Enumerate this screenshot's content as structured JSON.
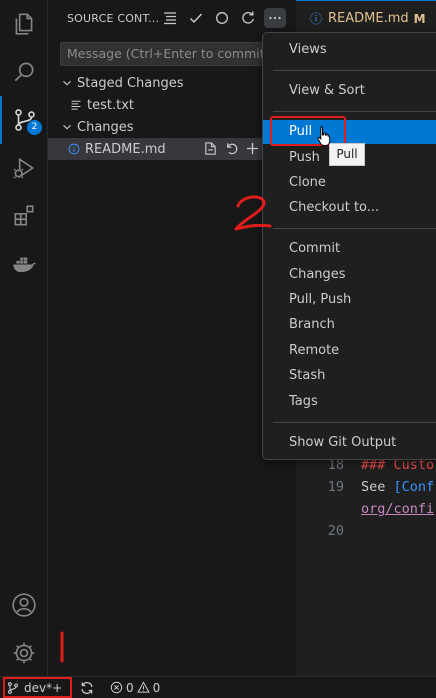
{
  "activity_bar": {
    "items": [
      {
        "name": "explorer",
        "icon": "files-icon"
      },
      {
        "name": "search",
        "icon": "search-icon"
      },
      {
        "name": "source-control",
        "icon": "source-control-icon",
        "badge": "2"
      },
      {
        "name": "run-debug",
        "icon": "run-debug-icon"
      },
      {
        "name": "extensions",
        "icon": "extensions-icon"
      },
      {
        "name": "docker",
        "icon": "docker-icon"
      }
    ],
    "bottom": [
      {
        "name": "accounts",
        "icon": "account-icon"
      },
      {
        "name": "manage",
        "icon": "gear-icon"
      }
    ]
  },
  "sidebar": {
    "title": "SOURCE CONT...",
    "commit_placeholder": "Message (Ctrl+Enter to commit on",
    "staged_label": "Staged Changes",
    "staged_files": [
      "test.txt"
    ],
    "changes_label": "Changes",
    "changed_files": [
      {
        "name": "README.md",
        "status_icon": "info-icon"
      }
    ]
  },
  "editor": {
    "tab_name": "README.md",
    "tab_status": "M",
    "lines": [
      {
        "num": "18",
        "text": "### Custo"
      },
      {
        "num": "19",
        "text_a": "See ",
        "text_b": "[Conf"
      },
      {
        "num": "",
        "text": "org/confi"
      },
      {
        "num": "20",
        "text": ""
      }
    ]
  },
  "menu": {
    "items": [
      {
        "label": "Views"
      },
      {
        "label": "View & Sort"
      },
      {
        "label": "Pull",
        "highlighted": true
      },
      {
        "label": "Push"
      },
      {
        "label": "Clone"
      },
      {
        "label": "Checkout to..."
      },
      {
        "label": "Commit"
      },
      {
        "label": "Changes"
      },
      {
        "label": "Pull, Push"
      },
      {
        "label": "Branch"
      },
      {
        "label": "Remote"
      },
      {
        "label": "Stash"
      },
      {
        "label": "Tags"
      },
      {
        "label": "Show Git Output"
      }
    ],
    "tooltip": "Pull"
  },
  "annotations": {
    "step_one": "1",
    "step_two": "2",
    "color": "#e01d1d"
  },
  "statusbar": {
    "branch": "dev*+",
    "errors": "0",
    "warnings": "0"
  },
  "colors": {
    "accent": "#0078d4",
    "highlight": "#e01d1d"
  }
}
